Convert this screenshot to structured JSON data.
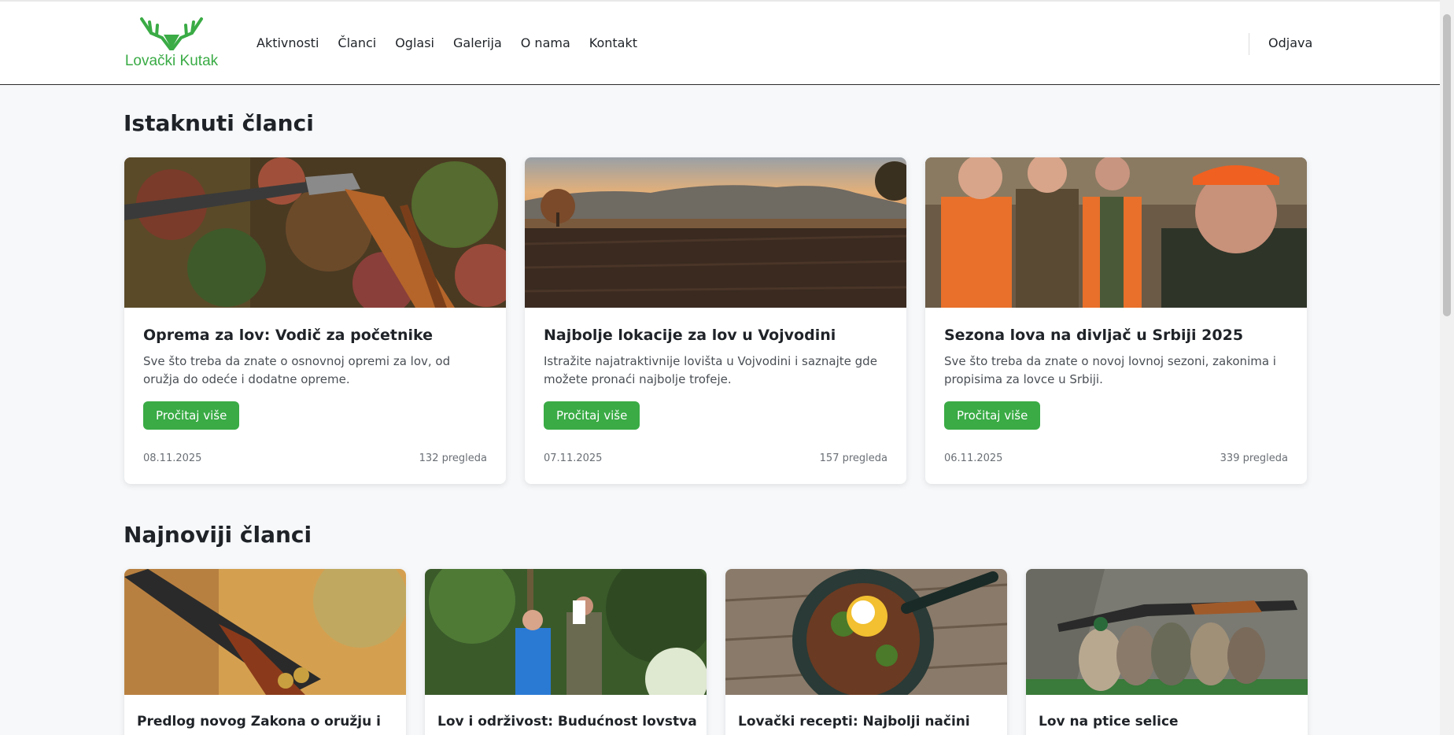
{
  "header": {
    "logo_text": "Lovački Kutak",
    "nav": [
      "Aktivnosti",
      "Članci",
      "Oglasi",
      "Galerija",
      "O nama",
      "Kontakt"
    ],
    "logout_label": "Odjava"
  },
  "colors": {
    "brand": "#3aab45",
    "background": "#f6f8fa",
    "card": "#ffffff"
  },
  "featured": {
    "title": "Istaknuti članci",
    "articles": [
      {
        "title": "Oprema za lov: Vodič za početnike",
        "excerpt": "Sve što treba da znate o osnovnoj opremi za lov, od oružja do odeće i dodatne opreme.",
        "button": "Pročitaj više",
        "date": "08.11.2025",
        "views": "132 pregleda",
        "image": "shotgun-autumn-leaves"
      },
      {
        "title": "Najbolje lokacije za lov u Vojvodini",
        "excerpt": "Istražite najatraktivnije lovišta u Vojvodini i saznajte gde možete pronaći najbolje trofeje.",
        "button": "Pročitaj više",
        "date": "07.11.2025",
        "views": "157 pregleda",
        "image": "field-sunset-landscape"
      },
      {
        "title": "Sezona lova na divljač u Srbiji 2025",
        "excerpt": "Sve što treba da znate o novoj lovnoj sezoni, zakonima i propisima za lovce u Srbiji.",
        "button": "Pročitaj više",
        "date": "06.11.2025",
        "views": "339 pregleda",
        "image": "hunters-group-selfie"
      }
    ]
  },
  "latest": {
    "title": "Najnoviji članci",
    "articles": [
      {
        "title": "Predlog novog Zakona o oružju i",
        "image": "shotgun-closeup"
      },
      {
        "title": "Lov i održivost: Budućnost lovstva",
        "image": "men-in-forest"
      },
      {
        "title": "Lovački recepti: Najbolji načini",
        "image": "stew-bowl"
      },
      {
        "title": "Lov na ptice selice",
        "image": "ducks-and-shotgun"
      }
    ]
  }
}
